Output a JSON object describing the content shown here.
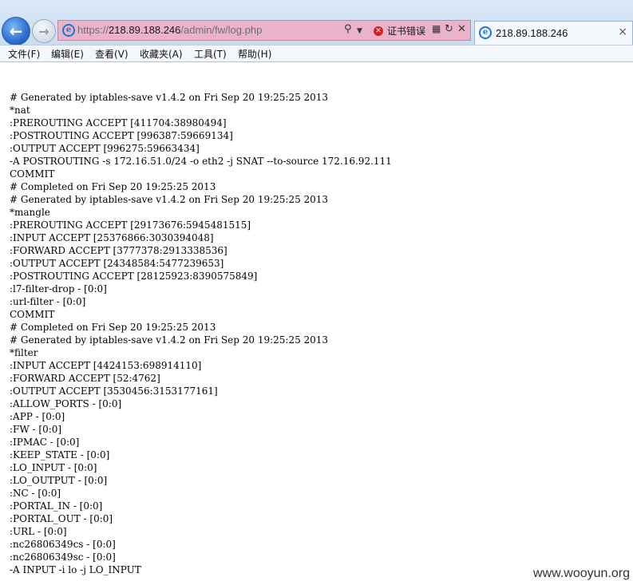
{
  "browser": {
    "url_prefix": "https://",
    "url_host": "218.89.188.246",
    "url_path": "/admin/fw/log.php",
    "search_glyph": "⚲",
    "cert_error_label": "证书错误",
    "tab_title": "218.89.188.246",
    "tab_close": "×",
    "icons": [
      "back-arrow-icon",
      "forward-arrow-icon",
      "ie-logo-icon",
      "search-icon",
      "cert-error-icon",
      "compat-view-icon",
      "refresh-icon",
      "stop-icon",
      "close-icon"
    ],
    "colors": {
      "address_bar": "#e9b4c9",
      "back_button": "#2a6fcf",
      "cert_error": "#d42020"
    }
  },
  "menu": {
    "items": [
      "文件(F)",
      "编辑(E)",
      "查看(V)",
      "收藏夹(A)",
      "工具(T)",
      "帮助(H)"
    ]
  },
  "log": {
    "lines": [
      "# Generated by iptables-save v1.4.2 on Fri Sep 20 19:25:25 2013",
      "*nat",
      ":PREROUTING ACCEPT [411704:38980494]",
      ":POSTROUTING ACCEPT [996387:59669134]",
      ":OUTPUT ACCEPT [996275:59663434]",
      "-A POSTROUTING -s 172.16.51.0/24 -o eth2 -j SNAT --to-source 172.16.92.111",
      "COMMIT",
      "# Completed on Fri Sep 20 19:25:25 2013",
      "# Generated by iptables-save v1.4.2 on Fri Sep 20 19:25:25 2013",
      "*mangle",
      ":PREROUTING ACCEPT [29173676:5945481515]",
      ":INPUT ACCEPT [25376866:3030394048]",
      ":FORWARD ACCEPT [3777378:2913338536]",
      ":OUTPUT ACCEPT [24348584:5477239653]",
      ":POSTROUTING ACCEPT [28125923:8390575849]",
      ":l7-filter-drop - [0:0]",
      ":url-filter - [0:0]",
      "COMMIT",
      "# Completed on Fri Sep 20 19:25:25 2013",
      "# Generated by iptables-save v1.4.2 on Fri Sep 20 19:25:25 2013",
      "*filter",
      ":INPUT ACCEPT [4424153:698914110]",
      ":FORWARD ACCEPT [52:4762]",
      ":OUTPUT ACCEPT [3530456:3153177161]",
      ":ALLOW_PORTS - [0:0]",
      ":APP - [0:0]",
      ":FW - [0:0]",
      ":IPMAC - [0:0]",
      ":KEEP_STATE - [0:0]",
      ":LO_INPUT - [0:0]",
      ":LO_OUTPUT - [0:0]",
      ":NC - [0:0]",
      ":PORTAL_IN - [0:0]",
      ":PORTAL_OUT - [0:0]",
      ":URL - [0:0]",
      ":nc26806349cs - [0:0]",
      ":nc26806349sc - [0:0]",
      "-A INPUT -i lo -j LO_INPUT"
    ]
  },
  "watermark": "www.wooyun.org"
}
